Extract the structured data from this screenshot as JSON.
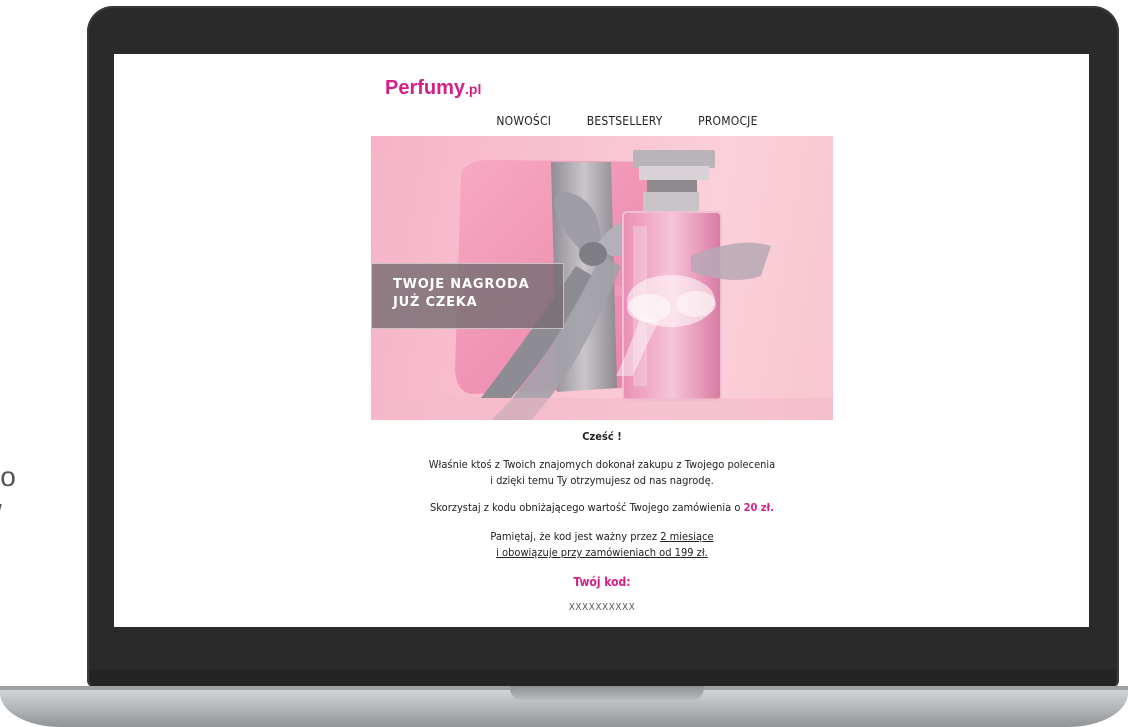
{
  "side_text": {
    "line1": "lo",
    "line2": "/"
  },
  "email": {
    "brand": {
      "name": "Perfumy",
      "tld": ".pl"
    },
    "nav": [
      "NOWOŚCI",
      "BESTSELLERY",
      "PROMOCJE"
    ],
    "hero": {
      "line1": "TWOJE NAGRODA",
      "line2": "JUŻ CZEKA"
    },
    "greeting": "Cześć !",
    "para1_line1": "Właśnie ktoś z Twoich znajomych dokonał zakupu z Twojego polecenia",
    "para1_line2": "i dzięki temu Ty otrzymujesz od nas nagrodę.",
    "para2_prefix": "Skorzystaj z kodu obniżającego wartość Twojego zamówienia o",
    "para2_amount": "20 zł.",
    "para3_prefix": "Pamiętaj, że kod jest ważny przez",
    "para3_duration": "2 miesiące",
    "para3_line2": "i obowiązuje przy zamówieniach od 199 zł.",
    "code_label": "Twój kod:",
    "code_value": "XXXXXXXXXX"
  },
  "colors": {
    "brand": "#d61f86",
    "laptop": "#2a2a2a"
  }
}
